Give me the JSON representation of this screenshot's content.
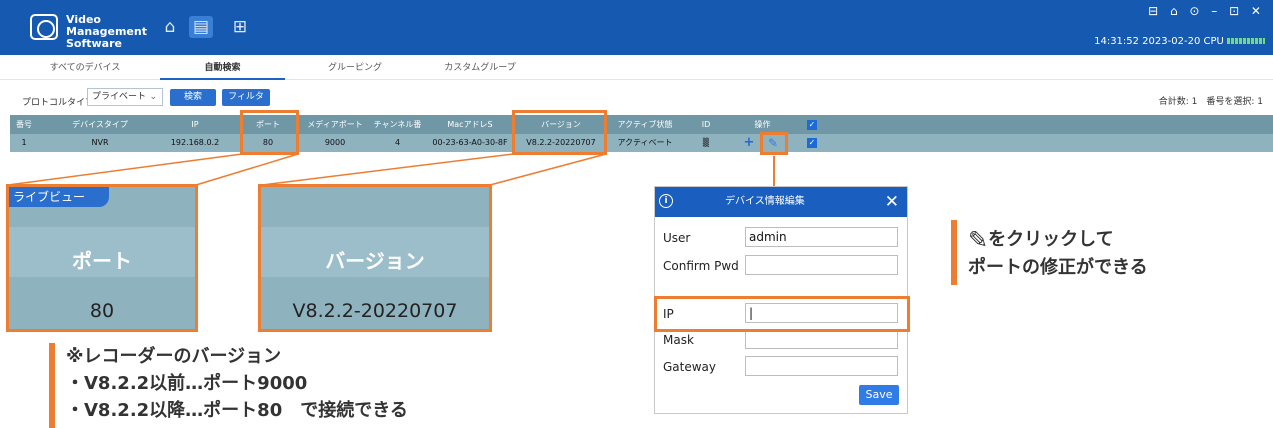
{
  "app": {
    "title_line1": "Video Management",
    "title_line2": "Software",
    "window_controls": "⊟ ⌂ ⊙ – ⊡ ✕"
  },
  "nav": {
    "home_icon": "home-icon",
    "devices_icon": "devices-icon",
    "layout_icon": "grid-icon"
  },
  "status": {
    "text": "14:31:52 2023-02-20 CPU"
  },
  "tabs": [
    {
      "label": "すべてのデバイス"
    },
    {
      "label": "自動検索"
    },
    {
      "label": "グルーピング"
    },
    {
      "label": "カスタムグループ"
    }
  ],
  "filter": {
    "protocol_label": "プロトコルタイプ:",
    "protocol_value": "プライベート",
    "search_label": "検索",
    "filter_label": "フィルタ",
    "summary": "合計数: 1　番号を選択: 1"
  },
  "table": {
    "headers": [
      "番号",
      "デバイスタイプ",
      "IP",
      "ポート",
      "メディアポート",
      "チャンネル番号",
      "MacアドレS",
      "バージョン",
      "アクティブ状態",
      "ID",
      "操作"
    ],
    "row": [
      "1",
      "NVR",
      "192.168.0.2",
      "80",
      "9000",
      "4",
      "00-23-63-A0-30-8F",
      "V8.2.2-20220707",
      "アクティベート",
      "▒"
    ]
  },
  "zoom": {
    "partial_tab": "ライブビュー",
    "port_label": "ポート",
    "port_value": "80",
    "version_label": "バージョン",
    "version_value": "V8.2.2-20220707"
  },
  "dialog": {
    "title": "デバイス情報編集",
    "user_label": "User",
    "user_value": "admin",
    "confirm_label": "Confirm Pwd",
    "confirm_value": "",
    "ip_label": "IP",
    "ip_value": "|",
    "mask_label": "Mask",
    "gateway_label": "Gateway",
    "save_label": "Save"
  },
  "notes": {
    "edit_line1": "をクリックして",
    "edit_line2": "ポートの修正ができる",
    "version_title": "※レコーダーのバージョン",
    "version_line1": "・V8.2.2以前…ポート9000",
    "version_line2": "・V8.2.2以降…ポート80　で接続できる"
  },
  "colors": {
    "brand": "#1559b0",
    "highlight": "#ed7d31",
    "row": "#8fb2bf",
    "header": "#6f97a6"
  }
}
